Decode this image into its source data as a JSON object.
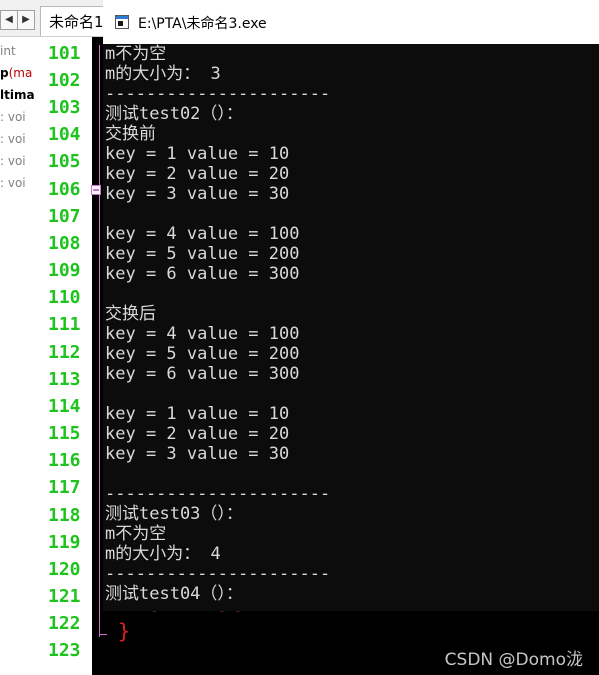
{
  "ide": {
    "tab_title": "未命名1",
    "nav_left": "◀",
    "nav_right": "▶",
    "class_items": [
      {
        "text": "int",
        "style": "dim"
      },
      {
        "text": "p",
        "extra": "(ma",
        "style": "bold-red"
      },
      {
        "text": "ltima",
        "style": "bold"
      },
      {
        "text": ": voi",
        "style": "dim"
      },
      {
        "text": ": voi",
        "style": "dim"
      },
      {
        "text": ": voi",
        "style": "dim"
      },
      {
        "text": ": voi",
        "style": "dim"
      }
    ],
    "line_numbers": [
      "101",
      "102",
      "103",
      "104",
      "105",
      "106",
      "107",
      "108",
      "109",
      "110",
      "111",
      "112",
      "113",
      "114",
      "115",
      "116",
      "117",
      "118",
      "119",
      "120",
      "121",
      "122",
      "123"
    ],
    "line_number_color": "#1ec31e",
    "closing_brace": "}",
    "code_fragment": "[ ·  ·  ·  [ ]"
  },
  "console": {
    "title": "E:\\PTA\\未命名3.exe",
    "text_color": "#d9d9d9",
    "background": "#0c0c0c",
    "lines": [
      "m不为空",
      "m的大小为： 3",
      "----------------------",
      "测试test02（）：",
      "交换前",
      "key = 1 value = 10",
      "key = 2 value = 20",
      "key = 3 value = 30",
      "",
      "key = 4 value = 100",
      "key = 5 value = 200",
      "key = 6 value = 300",
      "",
      "交换后",
      "key = 4 value = 100",
      "key = 5 value = 200",
      "key = 6 value = 300",
      "",
      "key = 1 value = 10",
      "key = 2 value = 20",
      "key = 3 value = 30",
      "",
      "----------------------",
      "测试test03（）：",
      "m不为空",
      "m的大小为： 4",
      "----------------------",
      "测试test04（）："
    ]
  },
  "watermark": "CSDN @Domo泷"
}
